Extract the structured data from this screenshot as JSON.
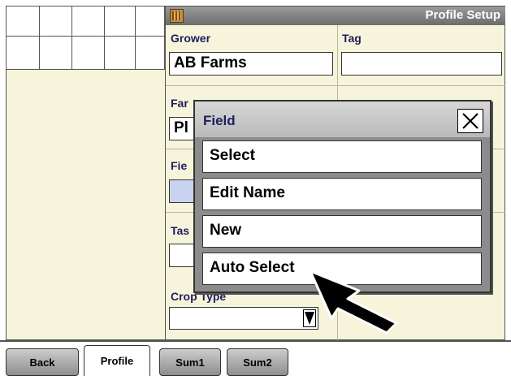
{
  "window": {
    "title": "Profile Setup",
    "icon": "monitor-icon"
  },
  "form": {
    "grower_label": "Grower",
    "grower_value": "AB Farms",
    "tag_label": "Tag",
    "tag_value": "",
    "farm_label": "Far",
    "farm_value": "Pl",
    "field_label": "Fie",
    "field_value": "",
    "task_label": "Tas",
    "task_value": "",
    "crop_type_label": "Crop Type",
    "crop_type_value": ""
  },
  "popup": {
    "title": "Field",
    "close_icon": "close-icon",
    "options": [
      {
        "label": "Select"
      },
      {
        "label": "Edit Name"
      },
      {
        "label": "New"
      },
      {
        "label": "Auto Select"
      }
    ]
  },
  "tabs": [
    {
      "label": "Back",
      "active": false
    },
    {
      "label": "Profile",
      "active": true
    },
    {
      "label": "Sum1",
      "active": false
    },
    {
      "label": "Sum2",
      "active": false
    }
  ],
  "colors": {
    "panel_bg": "#f7f4dc",
    "label_text": "#1e1e5a",
    "field_highlight": "#c9d3f0",
    "title_bar": "#7d7d7d"
  }
}
